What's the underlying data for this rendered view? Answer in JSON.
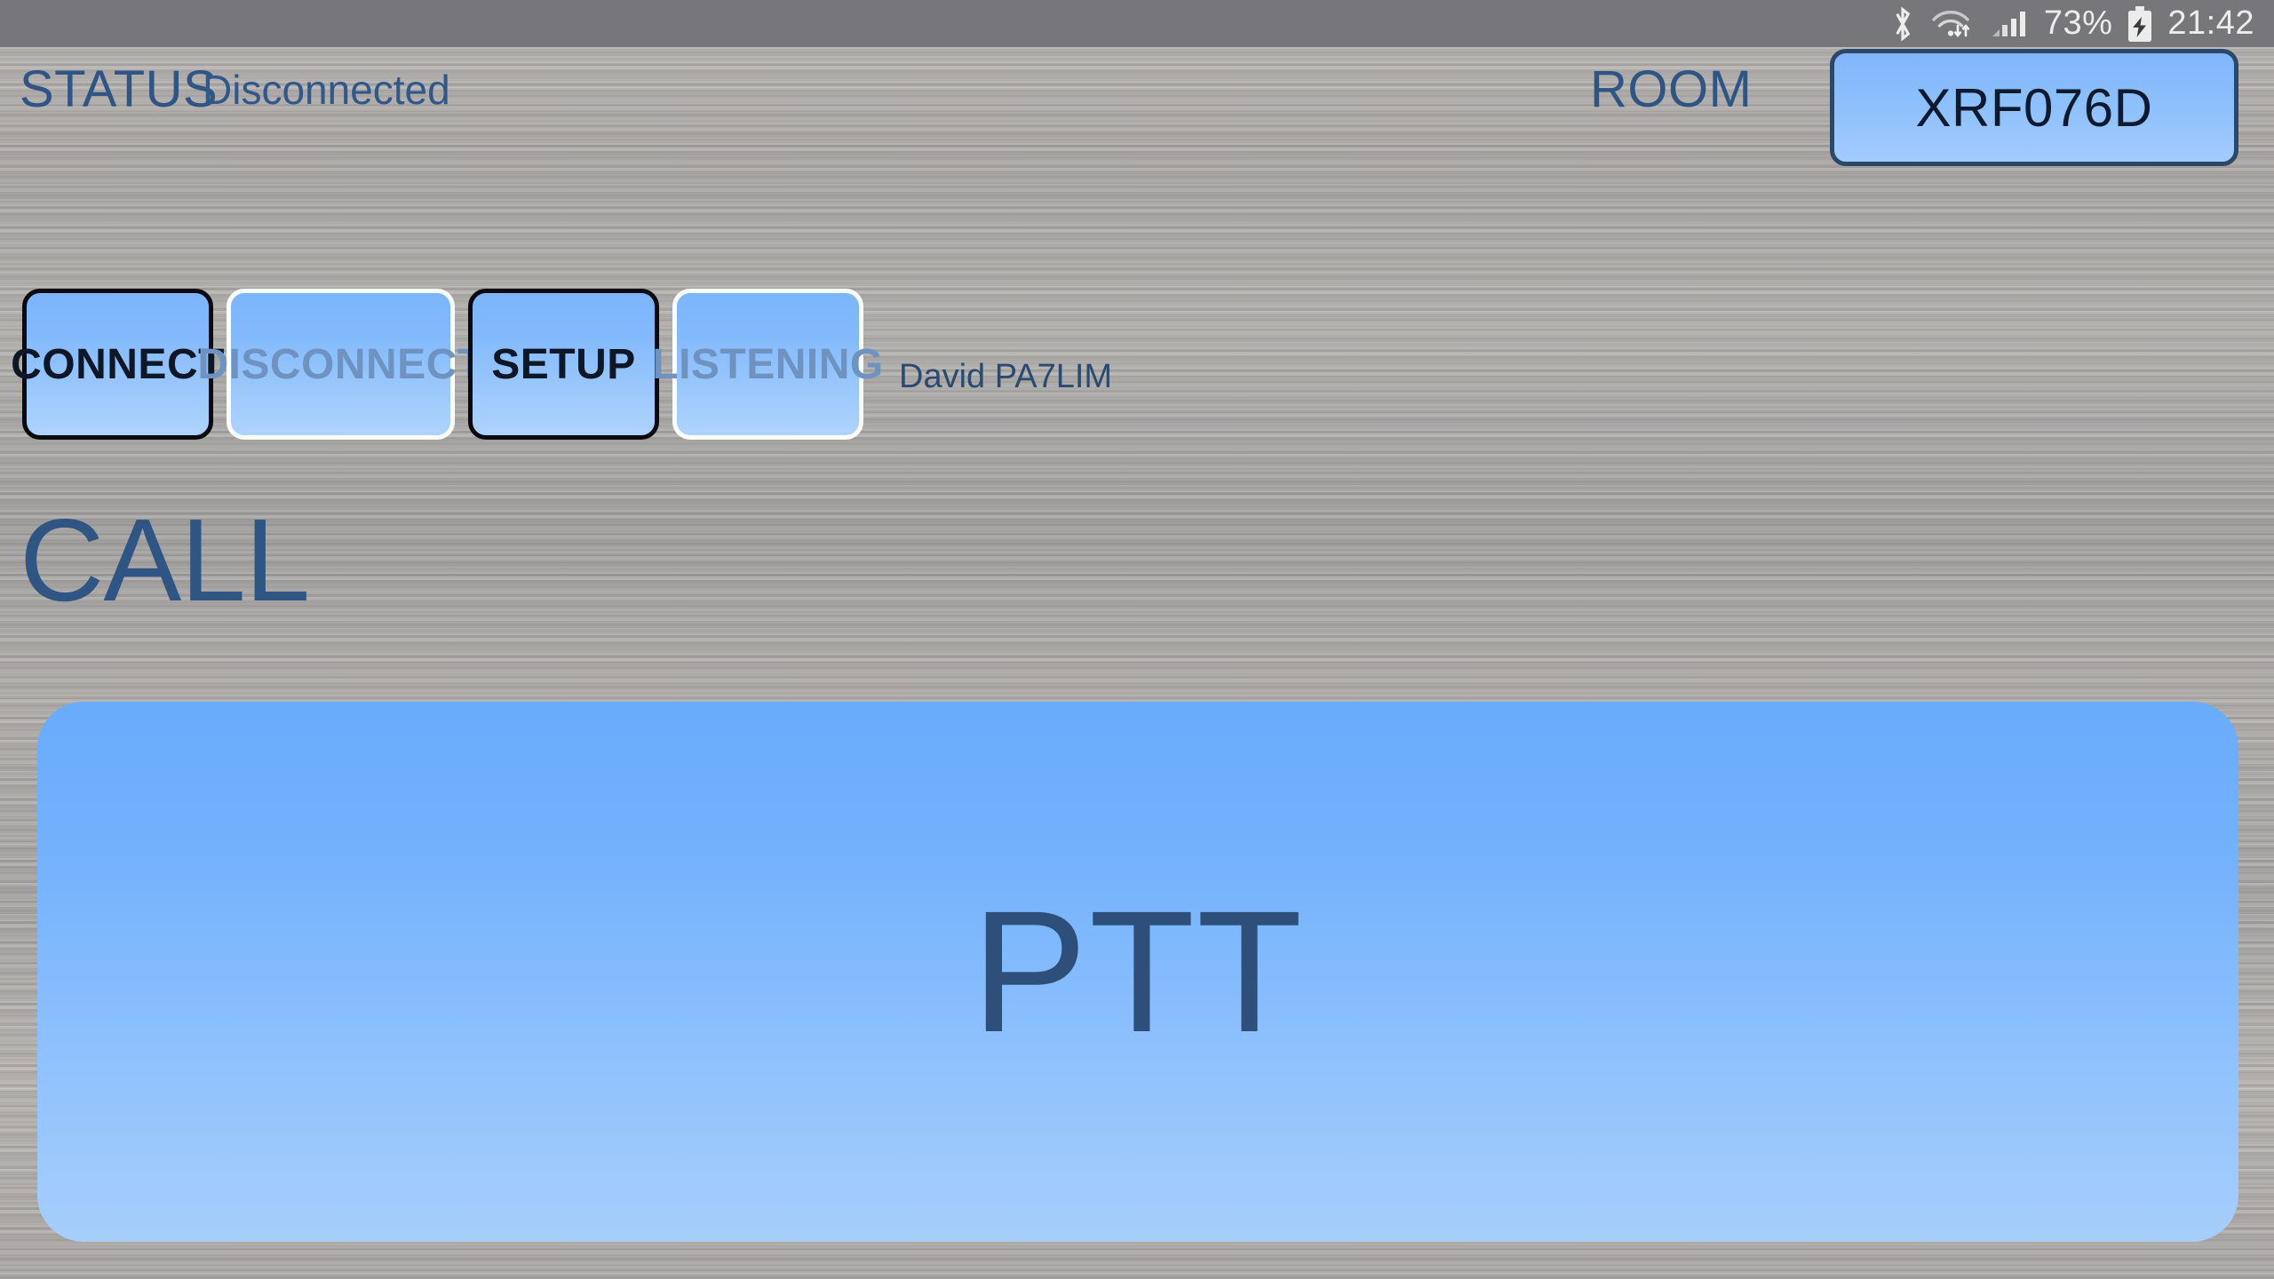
{
  "statusbar": {
    "icons": [
      {
        "name": "bluetooth-icon",
        "glyph": "ᛗ"
      },
      {
        "name": "wifi-icon",
        "glyph": "wifi"
      },
      {
        "name": "signal-icon",
        "glyph": "signal"
      },
      {
        "name": "battery-charging-icon",
        "glyph": "battery"
      }
    ],
    "battery_percent": "73%",
    "clock": "21:42"
  },
  "header": {
    "status_label": "STATUS",
    "status_value": "Disconnected",
    "room_label": "ROOM",
    "room_value": "XRF076D"
  },
  "actions": [
    {
      "name": "connect-button",
      "label": "CONNECT",
      "enabled": true
    },
    {
      "name": "disconnect-button",
      "label": "DISCONNECT",
      "enabled": false
    },
    {
      "name": "setup-button",
      "label": "SETUP",
      "enabled": true
    },
    {
      "name": "listening-button",
      "label": "LISTENING",
      "enabled": false
    }
  ],
  "buttons": {
    "connect": "CONNECT",
    "disconnect": "DISCONNECT",
    "setup": "SETUP",
    "listening": "LISTENING"
  },
  "callsign": "David PA7LIM",
  "call": {
    "label": "CALL",
    "value": ""
  },
  "ptt": {
    "label": "PTT"
  },
  "colors": {
    "accent_blue": "#7cb5fb",
    "label_blue": "#2e5584",
    "disabled_text": "#6e93c0",
    "metal_gray": "#a9a7a4",
    "statusbar_gray": "#77767a",
    "ptt_blue": "#69acfc"
  }
}
